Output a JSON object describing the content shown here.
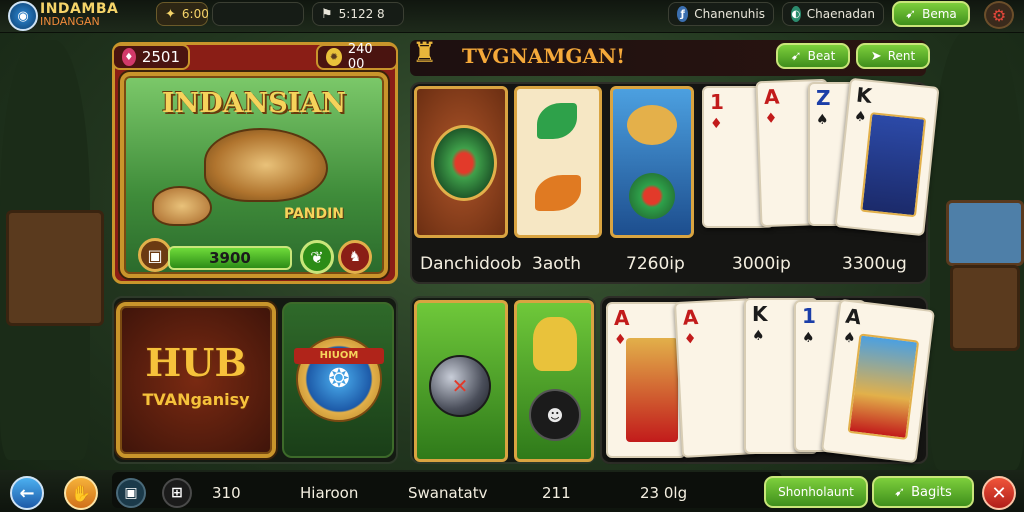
{
  "header": {
    "logo_main": "INDAMBA",
    "logo_sub": "INDANGAN",
    "coins_value": "6:00",
    "score_value": "5:122 8",
    "user_name": "Chanenuhis",
    "guild_name": "Chaenadan",
    "settings_label": "Bema"
  },
  "featured": {
    "coin_left": "2501",
    "coin_right": "240 00",
    "game_title": "INDANSIAN",
    "game_subtitle": "PANDIN",
    "prize_value": "3900"
  },
  "table_panel": {
    "title": "TVGNAMGAN!",
    "button_left": "Beat",
    "button_right": "Rent",
    "labels": [
      "Danchidoob",
      "3aoth",
      "7260ip",
      "3000ip",
      "3300ug"
    ]
  },
  "hub_panel": {
    "title": "HUB",
    "subtitle": "TVANganisy",
    "badge_text": "HIUOM"
  },
  "cards_bottom": {
    "ranks": [
      "A",
      "A",
      "K",
      "1",
      "A"
    ]
  },
  "cards_top": {
    "ranks": [
      "1",
      "A",
      "Z",
      "K"
    ]
  },
  "bottom_bar": {
    "stat1": "310",
    "stat2": "Hiaroon",
    "stat3": "Swanatatv",
    "stat4": "211",
    "stat5": "23 0lg",
    "button_left": "Shonholaunt",
    "button_right": "Bagits"
  },
  "colors": {
    "accent_green": "#5aae28",
    "gold": "#c9952b",
    "red": "#a3141b",
    "teal": "#1d6aa8"
  },
  "icons": [
    "back-arrow-icon",
    "hand-icon",
    "robot-icon",
    "shield-icon",
    "close-icon",
    "gear-icon",
    "leaf-icon",
    "trophy-icon"
  ]
}
